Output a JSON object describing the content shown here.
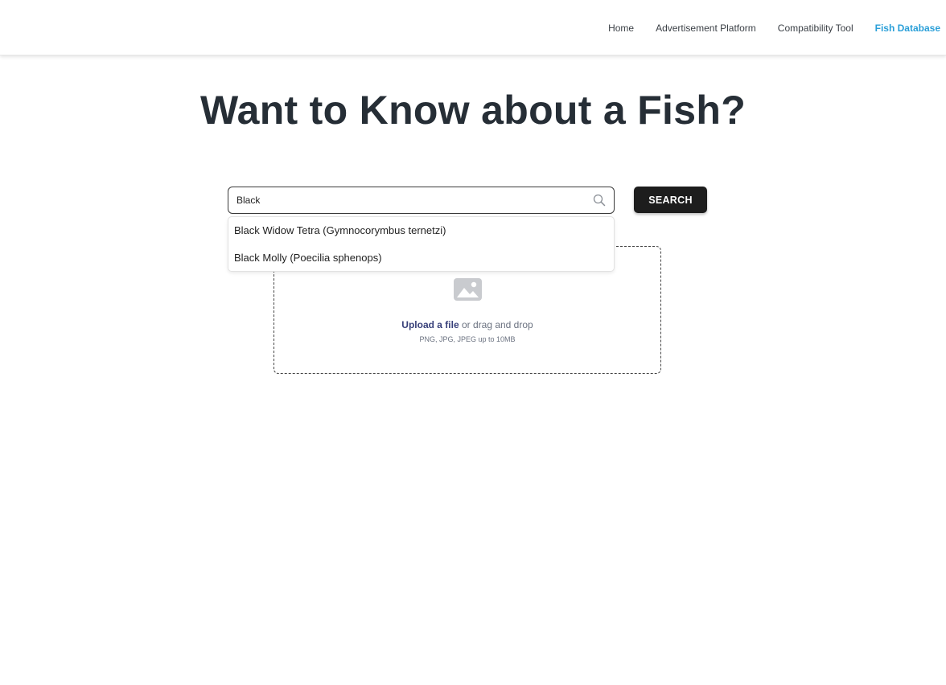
{
  "nav": {
    "items": [
      {
        "label": "Home",
        "active": false
      },
      {
        "label": "Advertisement Platform",
        "active": false
      },
      {
        "label": "Compatibility Tool",
        "active": false
      },
      {
        "label": "Fish Database",
        "active": true
      }
    ],
    "active_color": "#2a9fd8"
  },
  "page": {
    "title": "Want to Know about a Fish?"
  },
  "search": {
    "value": "Black",
    "placeholder": "",
    "button_label": "SEARCH",
    "icon": "search-icon"
  },
  "suggestions": [
    {
      "label": "Black Widow Tetra (Gymnocorymbus ternetzi)"
    },
    {
      "label": "Black Molly (Poecilia sphenops)"
    }
  ],
  "upload": {
    "icon": "image-icon",
    "link_label": "Upload a file",
    "text_after": " or drag and drop",
    "hint": "PNG, JPG, JPEG up to 10MB",
    "link_color": "#38407a"
  }
}
